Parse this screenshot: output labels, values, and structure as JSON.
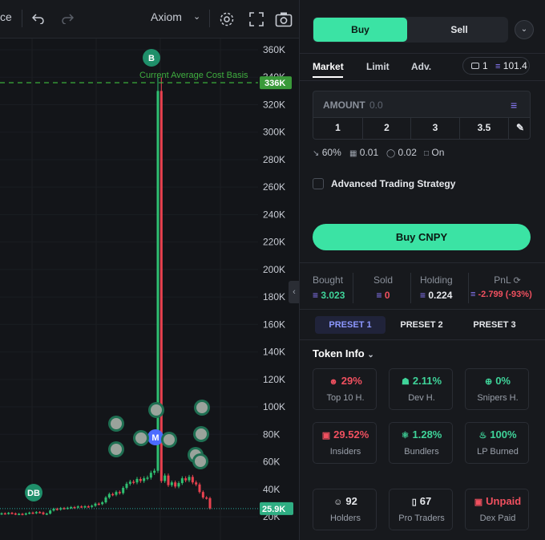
{
  "toolbar": {
    "left_cut_label": "ce",
    "undo_icon": "undo-icon",
    "redo_icon": "redo-icon",
    "indicator_label": "Axiom",
    "settings_icon": "gear-icon",
    "fullscreen_icon": "fullscreen-icon",
    "screenshot_icon": "camera-icon"
  },
  "chart": {
    "avg_cost_marker": "B",
    "avg_cost_label": "Current Average Cost Basis",
    "avg_cost_price_tag": "336K",
    "current_price_tag": "25.9K",
    "dev_marker": "DB",
    "migration_marker": "M",
    "colors": {
      "up": "#2fbf71",
      "down": "#e8424f",
      "avg_line": "#3fbf3f",
      "current_line": "#26a69a"
    }
  },
  "chart_data": {
    "type": "candlestick",
    "y_axis_ticks": [
      "360K",
      "340K",
      "320K",
      "300K",
      "280K",
      "260K",
      "240K",
      "220K",
      "200K",
      "180K",
      "160K",
      "140K",
      "120K",
      "100K",
      "80K",
      "60K",
      "40K",
      "20K"
    ],
    "ylim": [
      20000,
      365000
    ],
    "reference_lines": [
      {
        "label": "Current Average Cost Basis",
        "value": 336000
      },
      {
        "label": "25.9K",
        "value": 25900
      }
    ],
    "candles": [
      {
        "o": 22000,
        "c": 22500
      },
      {
        "o": 22500,
        "c": 22200
      },
      {
        "o": 22200,
        "c": 22800
      },
      {
        "o": 22800,
        "c": 22400
      },
      {
        "o": 22400,
        "c": 21800
      },
      {
        "o": 21800,
        "c": 22100
      },
      {
        "o": 22100,
        "c": 21700
      },
      {
        "o": 21700,
        "c": 22400
      },
      {
        "o": 22400,
        "c": 23000
      },
      {
        "o": 23000,
        "c": 22600
      },
      {
        "o": 22600,
        "c": 23400
      },
      {
        "o": 23400,
        "c": 23100
      },
      {
        "o": 23100,
        "c": 21900
      },
      {
        "o": 21900,
        "c": 22300
      },
      {
        "o": 22300,
        "c": 24500
      },
      {
        "o": 24500,
        "c": 25800
      },
      {
        "o": 25800,
        "c": 25200
      },
      {
        "o": 25200,
        "c": 26300
      },
      {
        "o": 26300,
        "c": 26000
      },
      {
        "o": 26000,
        "c": 26500
      },
      {
        "o": 26500,
        "c": 27000
      },
      {
        "o": 27000,
        "c": 26800
      },
      {
        "o": 26800,
        "c": 27500
      },
      {
        "o": 27500,
        "c": 27200
      },
      {
        "o": 27200,
        "c": 27600
      },
      {
        "o": 27600,
        "c": 27300
      },
      {
        "o": 27300,
        "c": 28000
      },
      {
        "o": 28000,
        "c": 29500
      },
      {
        "o": 29500,
        "c": 29200
      },
      {
        "o": 29200,
        "c": 30500
      },
      {
        "o": 30500,
        "c": 34000
      },
      {
        "o": 34000,
        "c": 36500
      },
      {
        "o": 36500,
        "c": 36000
      },
      {
        "o": 36000,
        "c": 38000
      },
      {
        "o": 38000,
        "c": 37200
      },
      {
        "o": 37200,
        "c": 41000
      },
      {
        "o": 41000,
        "c": 44000
      },
      {
        "o": 44000,
        "c": 45500
      },
      {
        "o": 45500,
        "c": 45000
      },
      {
        "o": 45000,
        "c": 47500
      },
      {
        "o": 47500,
        "c": 46000
      },
      {
        "o": 46000,
        "c": 48000
      },
      {
        "o": 48000,
        "c": 48500
      },
      {
        "o": 48500,
        "c": 52000
      },
      {
        "o": 52000,
        "c": 53500
      },
      {
        "o": 53500,
        "c": 330000
      },
      {
        "o": 330000,
        "c": 46000
      },
      {
        "o": 46000,
        "c": 50000
      },
      {
        "o": 50000,
        "c": 43000
      },
      {
        "o": 43000,
        "c": 45000
      },
      {
        "o": 45000,
        "c": 42000
      },
      {
        "o": 42000,
        "c": 44500
      },
      {
        "o": 44500,
        "c": 48000
      },
      {
        "o": 48000,
        "c": 46500
      },
      {
        "o": 46500,
        "c": 49000
      },
      {
        "o": 49000,
        "c": 45000
      },
      {
        "o": 45000,
        "c": 43500
      },
      {
        "o": 43500,
        "c": 38000
      },
      {
        "o": 38000,
        "c": 34000
      },
      {
        "o": 34000,
        "c": 33500
      },
      {
        "o": 33500,
        "c": 26000
      }
    ]
  },
  "trade": {
    "buy_tab": "Buy",
    "sell_tab": "Sell",
    "order_tabs": [
      "Market",
      "Limit",
      "Adv."
    ],
    "wallet_count": "1",
    "balance": "101.4",
    "amount_label": "AMOUNT",
    "amount_placeholder": "0.0",
    "quick_amounts": [
      "1",
      "2",
      "3",
      "3.5"
    ],
    "slippage": "60%",
    "priority_fee": "0.01",
    "bribe": "0.02",
    "mev": "On",
    "advanced_label": "Advanced Trading Strategy",
    "buy_button": "Buy CNPY",
    "position": {
      "bought_label": "Bought",
      "bought_value": "3.023",
      "sold_label": "Sold",
      "sold_value": "0",
      "holding_label": "Holding",
      "holding_value": "0.224",
      "pnl_label": "PnL",
      "pnl_value": "-2.799 (-93%)"
    },
    "presets": [
      "PRESET 1",
      "PRESET 2",
      "PRESET 3"
    ]
  },
  "token_info": {
    "title": "Token Info",
    "cards": [
      {
        "value": "29%",
        "label": "Top 10 H.",
        "color": "#f0505f",
        "icon": "users-icon"
      },
      {
        "value": "2.11%",
        "label": "Dev H.",
        "color": "#3fd49a",
        "icon": "chef-hat-icon"
      },
      {
        "value": "0%",
        "label": "Snipers H.",
        "color": "#3fd49a",
        "icon": "crosshair-icon"
      },
      {
        "value": "29.52%",
        "label": "Insiders",
        "color": "#f0505f",
        "icon": "ghost-icon"
      },
      {
        "value": "1.28%",
        "label": "Bundlers",
        "color": "#3fd49a",
        "icon": "bundle-icon"
      },
      {
        "value": "100%",
        "label": "LP Burned",
        "color": "#3fd49a",
        "icon": "flame-icon"
      },
      {
        "value": "92",
        "label": "Holders",
        "color": "#e6e8ec",
        "icon": "people-icon"
      },
      {
        "value": "67",
        "label": "Pro Traders",
        "color": "#e6e8ec",
        "icon": "candles-icon"
      },
      {
        "value": "Unpaid",
        "label": "Dex Paid",
        "color": "#f0505f",
        "icon": "badge-icon"
      }
    ]
  }
}
